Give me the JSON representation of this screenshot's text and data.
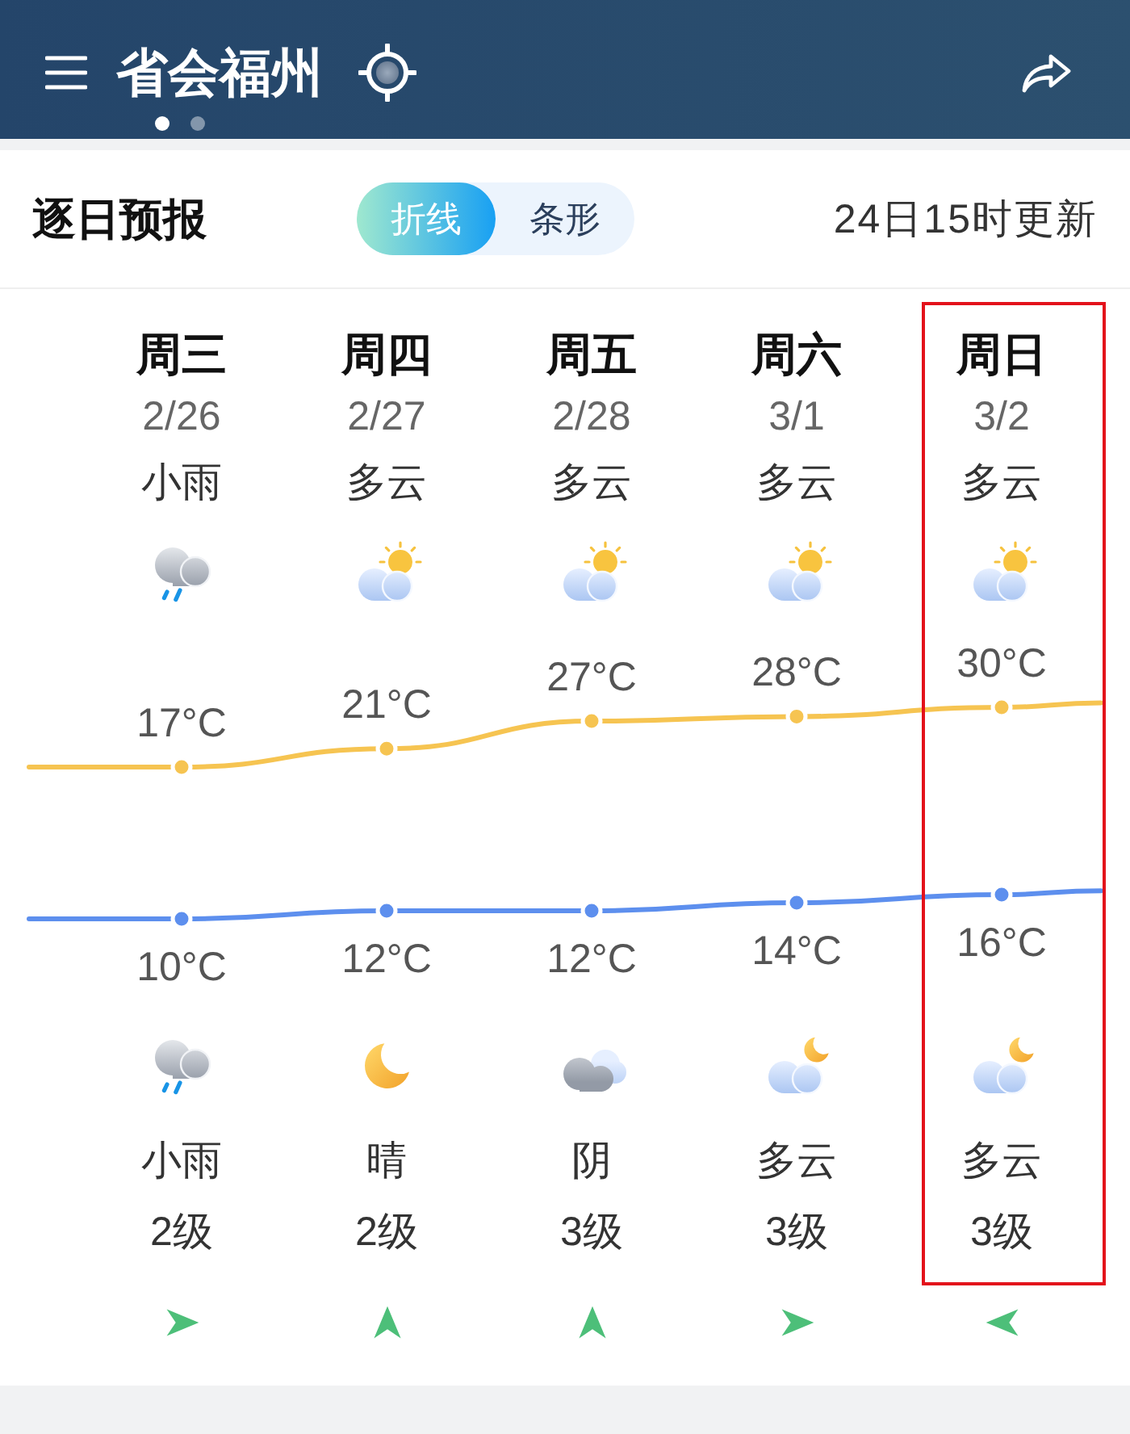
{
  "header": {
    "title": "省会福州",
    "page_dots": [
      {
        "selected": true
      },
      {
        "selected": false
      }
    ]
  },
  "forecast": {
    "title": "逐日预报",
    "view_tabs": [
      {
        "label": "折线",
        "selected": true
      },
      {
        "label": "条形",
        "selected": false
      }
    ],
    "updated": "24日15时更新",
    "days": [
      {
        "weekday": "周三",
        "date": "2/26",
        "day": {
          "text": "小雨",
          "kind": "rain"
        },
        "night": {
          "text": "小雨",
          "kind": "rain"
        },
        "wind": {
          "text": "2级",
          "kind": "east"
        },
        "highlighted": false
      },
      {
        "weekday": "周四",
        "date": "2/27",
        "day": {
          "text": "多云",
          "kind": "partly-cloudy"
        },
        "night": {
          "text": "晴",
          "kind": "clear"
        },
        "wind": {
          "text": "2级",
          "kind": "north"
        },
        "highlighted": false
      },
      {
        "weekday": "周五",
        "date": "2/28",
        "day": {
          "text": "多云",
          "kind": "partly-cloudy"
        },
        "night": {
          "text": "阴",
          "kind": "overcast"
        },
        "wind": {
          "text": "3级",
          "kind": "north"
        },
        "highlighted": false
      },
      {
        "weekday": "周六",
        "date": "3/1",
        "day": {
          "text": "多云",
          "kind": "partly-cloudy"
        },
        "night": {
          "text": "多云",
          "kind": "partly-cloudy"
        },
        "wind": {
          "text": "3级",
          "kind": "east"
        },
        "highlighted": false
      },
      {
        "weekday": "周日",
        "date": "3/2",
        "day": {
          "text": "多云",
          "kind": "partly-cloudy"
        },
        "night": {
          "text": "多云",
          "kind": "partly-cloudy"
        },
        "wind": {
          "text": "3级",
          "kind": "west"
        },
        "highlighted": true
      }
    ],
    "high_temperatures": {
      "chart_data": {
        "type": "line",
        "series": [
          {
            "color": "#f6c451",
            "marker": "o",
            "values": [
              17,
              21,
              27,
              28,
              30
            ],
            "value_labels": [
              "17°C",
              "21°C",
              "27°C",
              "28°C",
              "30°C"
            ]
          }
        ],
        "data_labels": true
      }
    },
    "low_temperatures": {
      "chart_data": {
        "type": "line",
        "series": [
          {
            "color": "#5d8fee",
            "marker": "o",
            "values": [
              10,
              12,
              12,
              14,
              16
            ],
            "value_labels": [
              "10°C",
              "12°C",
              "12°C",
              "14°C",
              "16°C"
            ]
          }
        ],
        "data_labels": true
      }
    }
  }
}
